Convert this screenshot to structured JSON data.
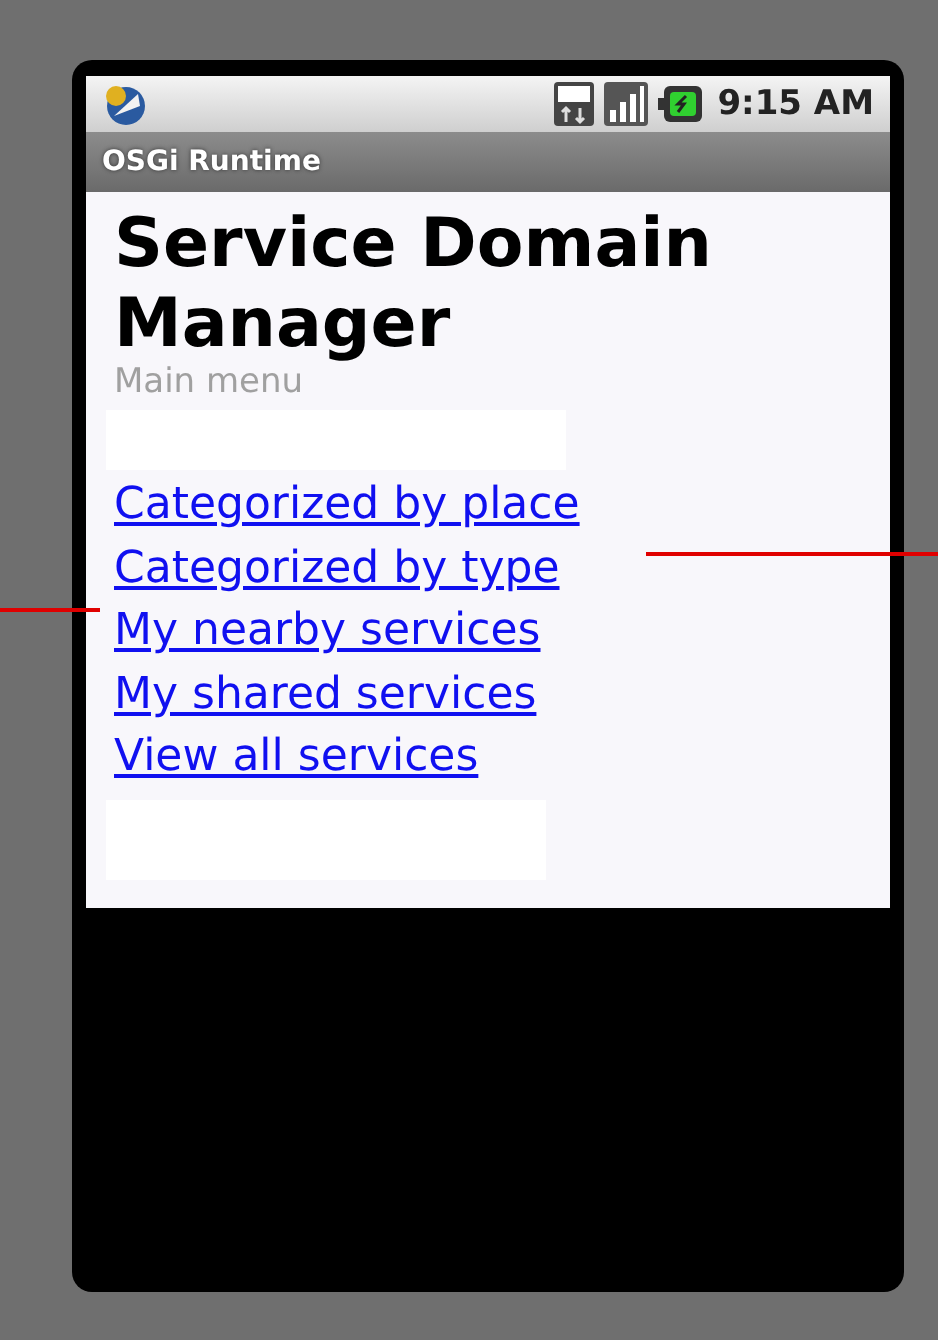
{
  "status_bar": {
    "time": "9:15 AM"
  },
  "title_bar": {
    "title": "OSGi Runtime"
  },
  "page": {
    "heading": "Service Domain Manager",
    "subtitle": "Main menu",
    "links": [
      {
        "label": "Categorized by place"
      },
      {
        "label": "Categorized by type"
      },
      {
        "label": "My nearby services"
      },
      {
        "label": "My shared services"
      },
      {
        "label": "View all services"
      }
    ]
  }
}
